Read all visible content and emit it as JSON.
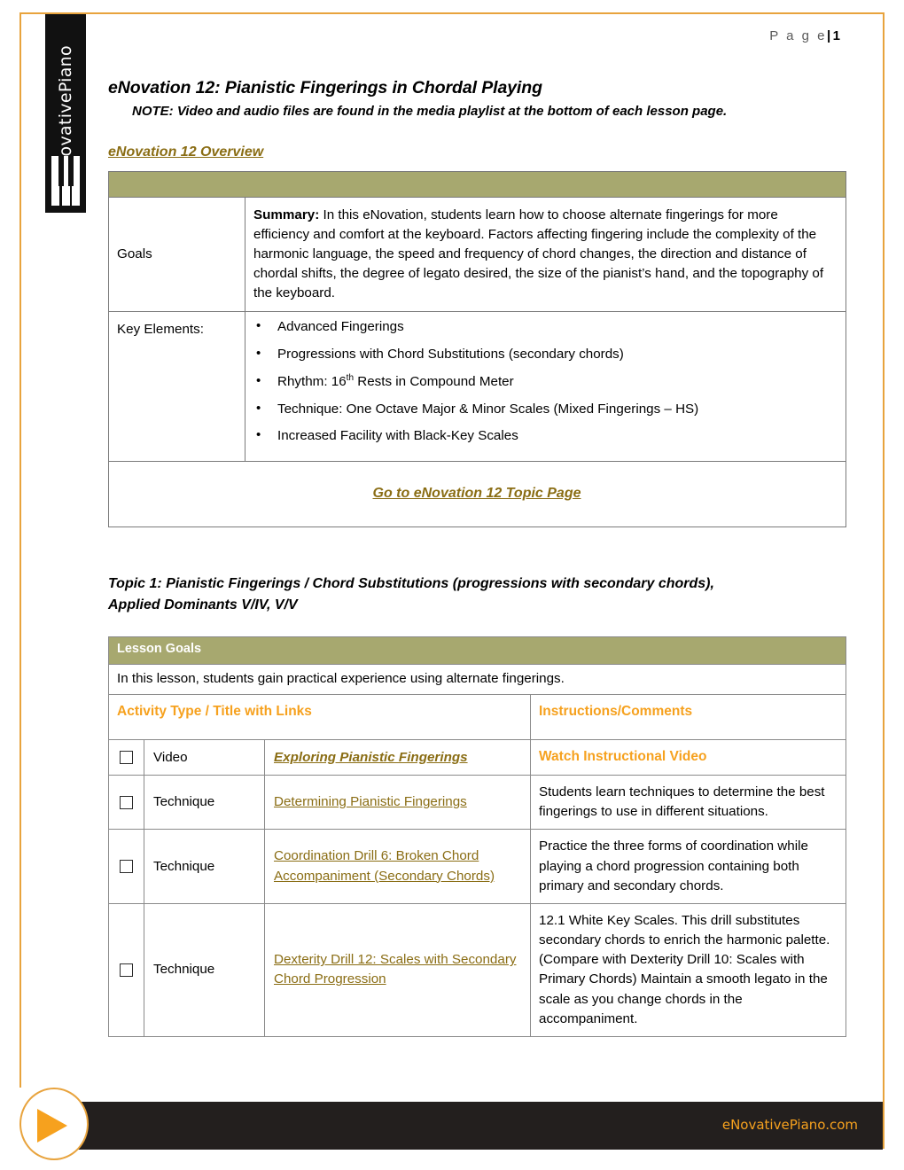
{
  "page": {
    "page_label": "P a g e",
    "page_separator": "|",
    "page_number": "1",
    "border_color": "#E8A33D"
  },
  "logo": {
    "wordmark": "eNovativePiano",
    "icon": "piano-keys-icon"
  },
  "header": {
    "title": "eNovation 12: Pianistic Fingerings in Chordal Playing",
    "note": "NOTE:  Video and audio files are found in the media playlist at the bottom of each lesson page.",
    "overview_link": "eNovation 12 Overview"
  },
  "overview_table": {
    "goals_label": "Goals",
    "summary_prefix": "Summary:",
    "summary_text": " In this eNovation, students learn how to choose alternate fingerings for more efficiency and comfort at the keyboard. Factors affecting fingering include the complexity of the harmonic language, the speed and frequency of chord changes, the direction and distance of chordal shifts, the degree of legato desired, the size of the pianist’s hand, and the topography of the keyboard.",
    "key_elements_label": "Key Elements:",
    "key_elements": [
      {
        "pre": "Advanced Fingerings",
        "sup": "",
        "post": ""
      },
      {
        "pre": "Progressions with Chord Substitutions (secondary chords)",
        "sup": "",
        "post": ""
      },
      {
        "pre": "Rhythm: 16",
        "sup": "th",
        "post": " Rests in Compound Meter"
      },
      {
        "pre": "Technique:  One Octave Major & Minor Scales (Mixed Fingerings – HS)",
        "sup": "",
        "post": ""
      },
      {
        "pre": "Increased Facility with Black-Key Scales",
        "sup": "",
        "post": ""
      }
    ],
    "topic_page_link": "Go to eNovation 12 Topic Page",
    "header_bar_color": "#A7A86F"
  },
  "topic": {
    "heading_line1": "Topic 1: Pianistic Fingerings / Chord Substitutions (progressions with secondary chords),",
    "heading_line2": " Applied Dominants V/IV, V/V"
  },
  "lesson_table": {
    "lesson_goals_title": "Lesson Goals",
    "lesson_goals_text": "In this lesson, students gain practical experience using alternate fingerings.",
    "col_activity": "Activity Type / Title with Links",
    "col_instructions": "Instructions/Comments",
    "accent_color": "#F6A11E",
    "link_color": "#8a6d14",
    "rows": [
      {
        "checkbox": "unchecked",
        "type": "Video",
        "title": "Exploring Pianistic Fingerings",
        "title_style": "italic",
        "instructions": "Watch Instructional Video",
        "instructions_style": "accent"
      },
      {
        "checkbox": "unchecked",
        "type": "Technique",
        "title": "Determining Pianistic Fingerings",
        "title_style": "plain",
        "instructions": "Students learn techniques to determine the best fingerings to use in different situations.",
        "instructions_style": "plain"
      },
      {
        "checkbox": "unchecked",
        "type": "Technique",
        "title": "Coordination Drill 6: Broken Chord Accompaniment (Secondary Chords)",
        "title_style": "plain",
        "instructions": "Practice the three forms of coordination while playing a chord progression containing both primary and secondary chords.",
        "instructions_style": "plain"
      },
      {
        "checkbox": "unchecked",
        "type": "Technique",
        "title": "Dexterity Drill 12: Scales with Secondary Chord Progression",
        "title_style": "plain",
        "instructions": "12.1 White Key Scales. This drill substitutes secondary chords to enrich the harmonic palette. (Compare with Dexterity Drill 10: Scales with Primary Chords) Maintain a smooth legato in the scale as you change chords in the accompaniment.",
        "instructions_style": "plain"
      }
    ]
  },
  "footer": {
    "site": "eNovativePiano.com",
    "play_icon": "play-triangle-icon",
    "bar_color": "#231F1E"
  }
}
